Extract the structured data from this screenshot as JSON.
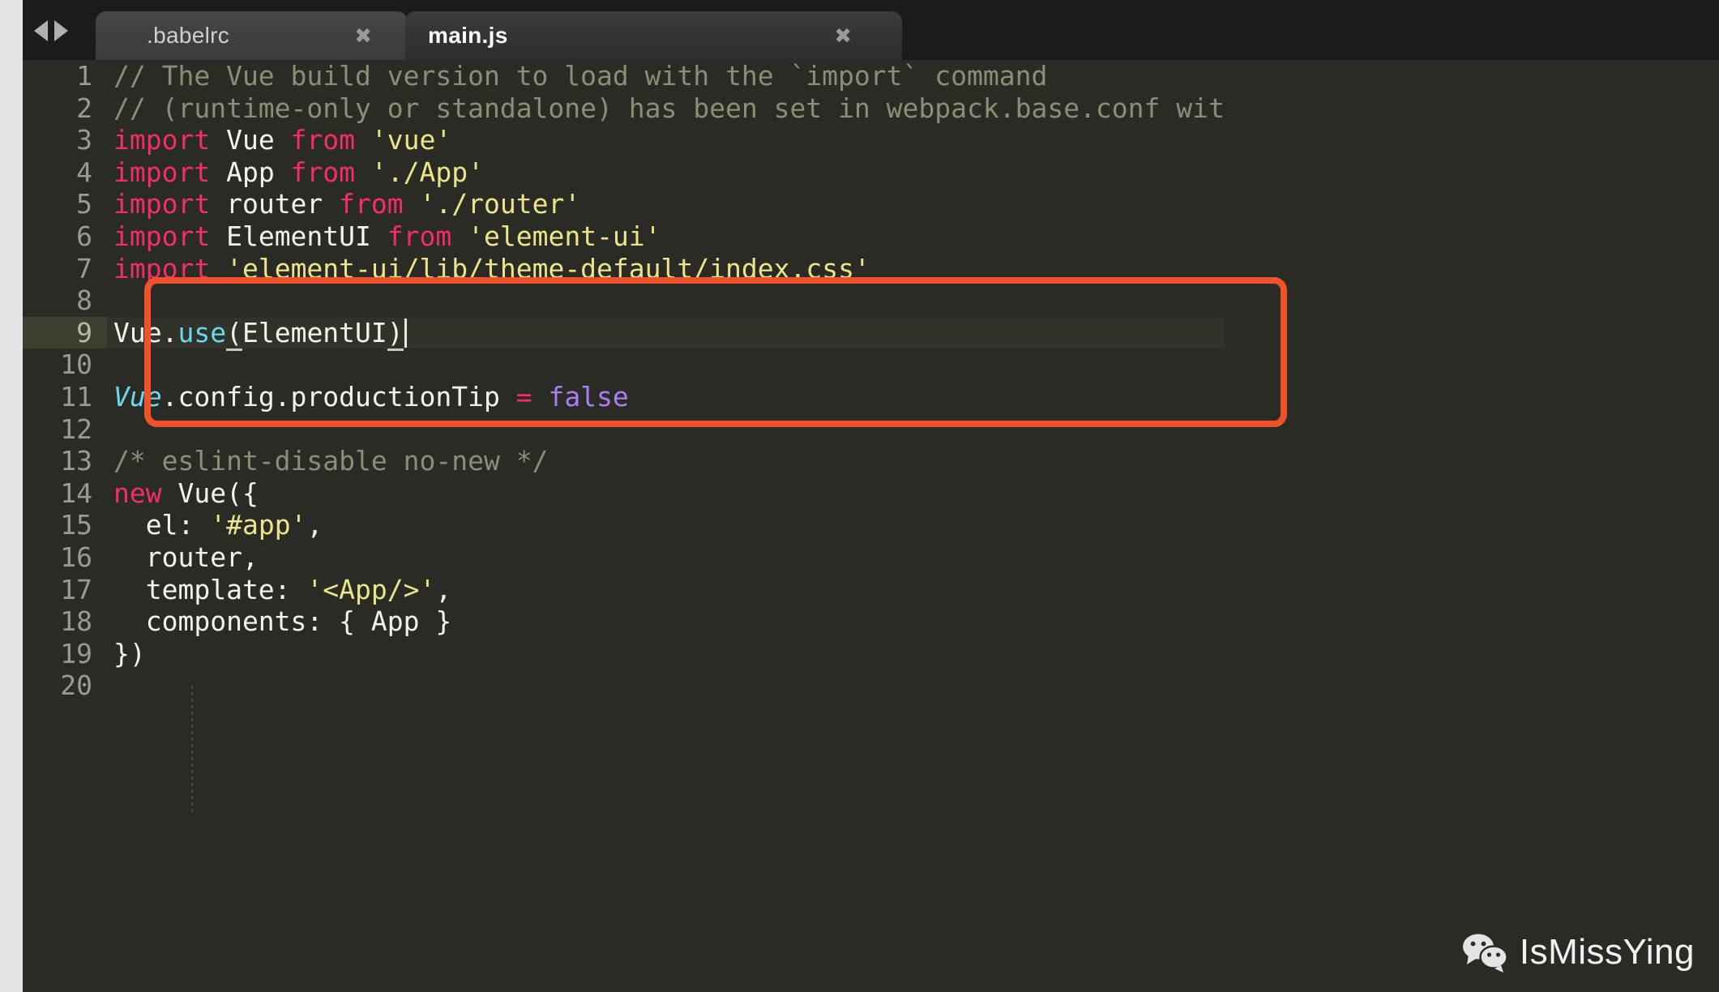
{
  "window": {
    "title": "main.js",
    "background": "#2b2b26",
    "tabbar_background": "#1b1b1b"
  },
  "tabbar": {
    "nav_prev_icon": "triangle-left-icon",
    "nav_next_icon": "triangle-right-icon",
    "close_glyph": "✖",
    "tabs": [
      {
        "label": ".babelrc",
        "active": false
      },
      {
        "label": "main.js",
        "active": true
      }
    ]
  },
  "annotation": {
    "color": "#f0522b",
    "shape": "rounded-rectangle",
    "covers_lines": "6-9"
  },
  "editor": {
    "active_line": 9,
    "cursor_line": 9,
    "cursor_column": 21,
    "total_lines_shown": 20,
    "lines": [
      {
        "n": "1",
        "tokens": [
          {
            "t": "comment",
            "v": "// The Vue build version to load with the `import` command"
          }
        ]
      },
      {
        "n": "2",
        "tokens": [
          {
            "t": "comment",
            "v": "// (runtime-only or standalone) has been set in webpack.base.conf wit"
          }
        ]
      },
      {
        "n": "3",
        "tokens": [
          {
            "t": "kw",
            "v": "import"
          },
          {
            "t": "plain",
            "v": " Vue "
          },
          {
            "t": "kw",
            "v": "from"
          },
          {
            "t": "plain",
            "v": " "
          },
          {
            "t": "str",
            "v": "'vue'"
          }
        ]
      },
      {
        "n": "4",
        "tokens": [
          {
            "t": "kw",
            "v": "import"
          },
          {
            "t": "plain",
            "v": " App "
          },
          {
            "t": "kw",
            "v": "from"
          },
          {
            "t": "plain",
            "v": " "
          },
          {
            "t": "str",
            "v": "'./App'"
          }
        ]
      },
      {
        "n": "5",
        "tokens": [
          {
            "t": "kw",
            "v": "import"
          },
          {
            "t": "plain",
            "v": " router "
          },
          {
            "t": "kw",
            "v": "from"
          },
          {
            "t": "plain",
            "v": " "
          },
          {
            "t": "str",
            "v": "'./router'"
          }
        ]
      },
      {
        "n": "6",
        "tokens": [
          {
            "t": "kw",
            "v": "import"
          },
          {
            "t": "plain",
            "v": " ElementUI "
          },
          {
            "t": "kw",
            "v": "from"
          },
          {
            "t": "plain",
            "v": " "
          },
          {
            "t": "str",
            "v": "'element-ui'"
          }
        ]
      },
      {
        "n": "7",
        "tokens": [
          {
            "t": "kw",
            "v": "import"
          },
          {
            "t": "plain",
            "v": " "
          },
          {
            "t": "str",
            "v": "'element-ui/lib/theme-default/index.css'"
          }
        ]
      },
      {
        "n": "8",
        "tokens": []
      },
      {
        "n": "9",
        "tokens": [
          {
            "t": "plain",
            "v": "Vue."
          },
          {
            "t": "fn",
            "v": "use"
          },
          {
            "t": "brace",
            "v": "("
          },
          {
            "t": "plain",
            "v": "ElementUI"
          },
          {
            "t": "brace",
            "v": ")"
          }
        ]
      },
      {
        "n": "10",
        "tokens": []
      },
      {
        "n": "11",
        "tokens": [
          {
            "t": "italic",
            "v": "Vue"
          },
          {
            "t": "plain",
            "v": ".config.productionTip "
          },
          {
            "t": "op",
            "v": "="
          },
          {
            "t": "plain",
            "v": " "
          },
          {
            "t": "const",
            "v": "false"
          }
        ]
      },
      {
        "n": "12",
        "tokens": []
      },
      {
        "n": "13",
        "tokens": [
          {
            "t": "comment",
            "v": "/* eslint-disable no-new */"
          }
        ]
      },
      {
        "n": "14",
        "tokens": [
          {
            "t": "kw",
            "v": "new"
          },
          {
            "t": "plain",
            "v": " Vue({"
          }
        ]
      },
      {
        "n": "15",
        "tokens": [
          {
            "t": "plain",
            "v": "  el: "
          },
          {
            "t": "str",
            "v": "'#app'"
          },
          {
            "t": "plain",
            "v": ","
          }
        ]
      },
      {
        "n": "16",
        "tokens": [
          {
            "t": "plain",
            "v": "  router,"
          }
        ]
      },
      {
        "n": "17",
        "tokens": [
          {
            "t": "plain",
            "v": "  template: "
          },
          {
            "t": "str",
            "v": "'<App/>'"
          },
          {
            "t": "plain",
            "v": ","
          }
        ]
      },
      {
        "n": "18",
        "tokens": [
          {
            "t": "plain",
            "v": "  components: { App }"
          }
        ]
      },
      {
        "n": "19",
        "tokens": [
          {
            "t": "plain",
            "v": "})"
          }
        ]
      },
      {
        "n": "20",
        "tokens": []
      }
    ]
  },
  "watermark": {
    "icon": "wechat-icon",
    "text": "IsMissYing"
  },
  "theme": {
    "background": "#2b2b26",
    "keyword": "#f42c68",
    "string": "#ece48b",
    "comment": "#8d8d76",
    "function": "#66d9ef",
    "constant": "#ab7df8",
    "plain": "#f4f2ed",
    "gutter": "#9a9a8f",
    "active_line": "#32322a"
  }
}
